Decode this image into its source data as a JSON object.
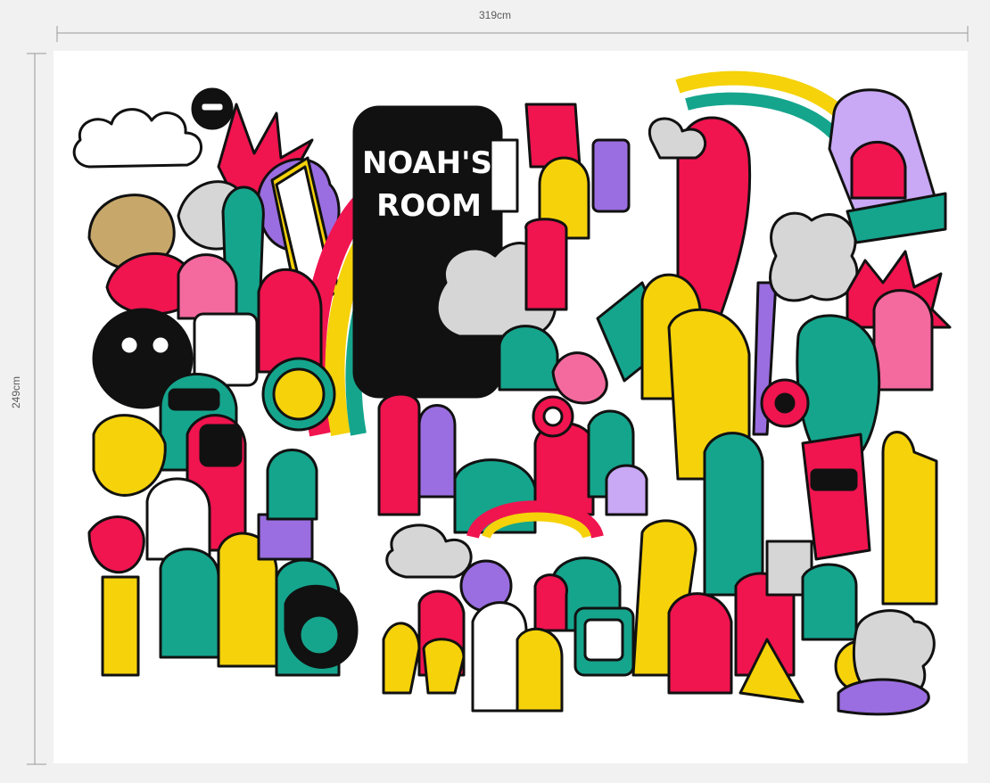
{
  "dimensions": {
    "width_label": "319cm",
    "height_label": "249cm"
  },
  "wallpaper": {
    "title_line1": "NOAH'S",
    "title_line2": "ROOM",
    "colors": {
      "magenta": "#f0144f",
      "teal": "#15a58d",
      "yellow": "#f5d20a",
      "purple": "#9a6ee0",
      "lilac": "#c9a8f5",
      "pink": "#f46a9e",
      "black": "#111111",
      "grey": "#d6d6d6"
    }
  }
}
